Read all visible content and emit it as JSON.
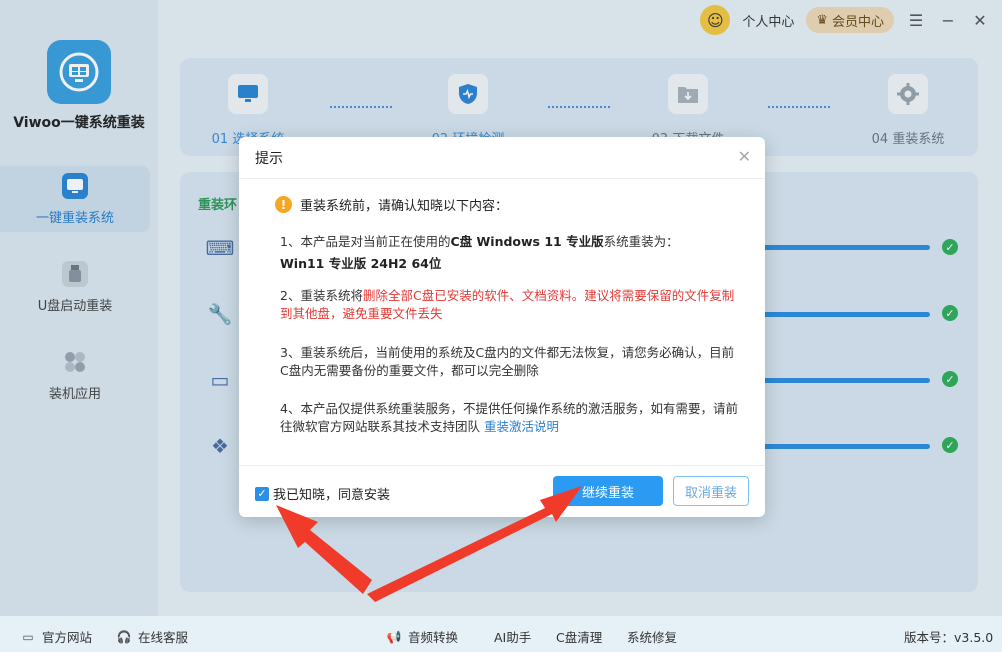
{
  "app": {
    "name": "Viwoo一键系统重装"
  },
  "topbar": {
    "personal_center": "个人中心",
    "vip_center": "会员中心",
    "menu_icon": "menu-icon",
    "minimize_icon": "minimize-icon",
    "close_icon": "close-icon"
  },
  "sidebar": {
    "items": [
      {
        "label": "一键重装系统",
        "icon": "monitor-reinstall-icon",
        "active": true
      },
      {
        "label": "U盘启动重装",
        "icon": "usb-drive-icon",
        "active": false
      },
      {
        "label": "装机应用",
        "icon": "apps-icon",
        "active": false
      }
    ]
  },
  "steps": [
    {
      "label": "01 选择系统",
      "icon": "monitor-select-icon"
    },
    {
      "label": "02 环境检测",
      "icon": "shield-check-icon"
    },
    {
      "label": "03 下载文件",
      "icon": "download-icon"
    },
    {
      "label": "04 重装系统",
      "icon": "gear-icon"
    }
  ],
  "main": {
    "title": "重装环"
  },
  "dialog": {
    "title": "提示",
    "warning": "重装系统前，请确认知晓以下内容：",
    "para1_text": "1、本产品是对当前正在使用的",
    "para1_bold": "C盘 Windows 11 专业版",
    "para1_text2": "系统重装为：",
    "para1_line2": "Win11 专业版 24H2 64位",
    "para2_text": "2、重装系统将",
    "para2_red": "删除全部C盘已安装的软件、文档资料。建议将需要保留的文件复制到其他盘，避免重要文件丢失",
    "para3": "3、重装系统后，当前使用的系统及C盘内的文件都无法恢复，请您务必确认，目前C盘内无需要备份的重要文件，都可以完全删除",
    "para4_text": "4、本产品仅提供系统重装服务，不提供任何操作系统的激活服务，如有需要，请前往微软官方网站联系其技术支持团队 ",
    "para4_link": "重装激活说明",
    "agree_label": "我已知晓，同意安装",
    "agree_checked": true,
    "confirm_button": "继续重装",
    "cancel_button": "取消重装"
  },
  "footer": {
    "official_site": "官方网站",
    "online_service": "在线客服",
    "audio_convert": "音频转换",
    "ai_assistant": "AI助手",
    "c_cleanup": "C盘清理",
    "system_repair": "系统修复",
    "version": "版本号：v3.5.0"
  },
  "colors": {
    "accent": "#2b9af3",
    "danger": "#e53935",
    "success": "#2fae5a",
    "arrow": "#f03a2a"
  }
}
